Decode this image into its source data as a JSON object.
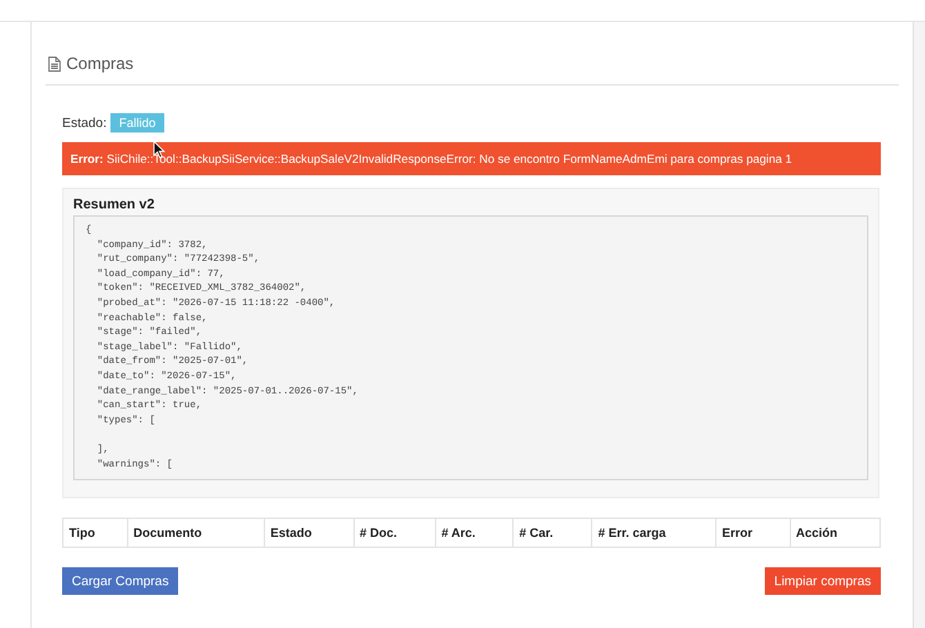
{
  "panel": {
    "title": "Compras"
  },
  "status": {
    "label": "Estado:",
    "badge": "Fallido"
  },
  "error": {
    "prefix": "Error:",
    "message": "SiiChile::Tool::BackupSiiService::BackupSaleV2InvalidResponseError: No se encontro FormNameAdmEmi para compras pagina 1"
  },
  "summary": {
    "title": "Resumen v2",
    "lines": [
      "{",
      "  \"company_id\": 3782,",
      "  \"rut_company\": \"77242398-5\",",
      "  \"load_company_id\": 77,",
      "  \"token\": \"RECEIVED_XML_3782_364002\",",
      "  \"probed_at\": \"2026-07-15 11:18:22 -0400\",",
      "  \"reachable\": false,",
      "  \"stage\": \"failed\",",
      "  \"stage_label\": \"Fallido\",",
      "  \"date_from\": \"2025-07-01\",",
      "  \"date_to\": \"2026-07-15\",",
      "  \"date_range_label\": \"2025-07-01..2026-07-15\",",
      "  \"can_start\": true,",
      "  \"types\": [",
      {
        "text": "  ],",
        "blank_before": true
      },
      "  \"warnings\": ["
    ]
  },
  "table": {
    "columns": [
      "Tipo",
      "Documento",
      "Estado",
      "# Doc.",
      "# Arc.",
      "# Car.",
      "# Err. carga",
      "Error",
      "Acción"
    ]
  },
  "buttons": [
    {
      "label": "Cargar Compras",
      "kind": "primary"
    },
    {
      "label": "Limpiar compras",
      "kind": "danger"
    }
  ]
}
